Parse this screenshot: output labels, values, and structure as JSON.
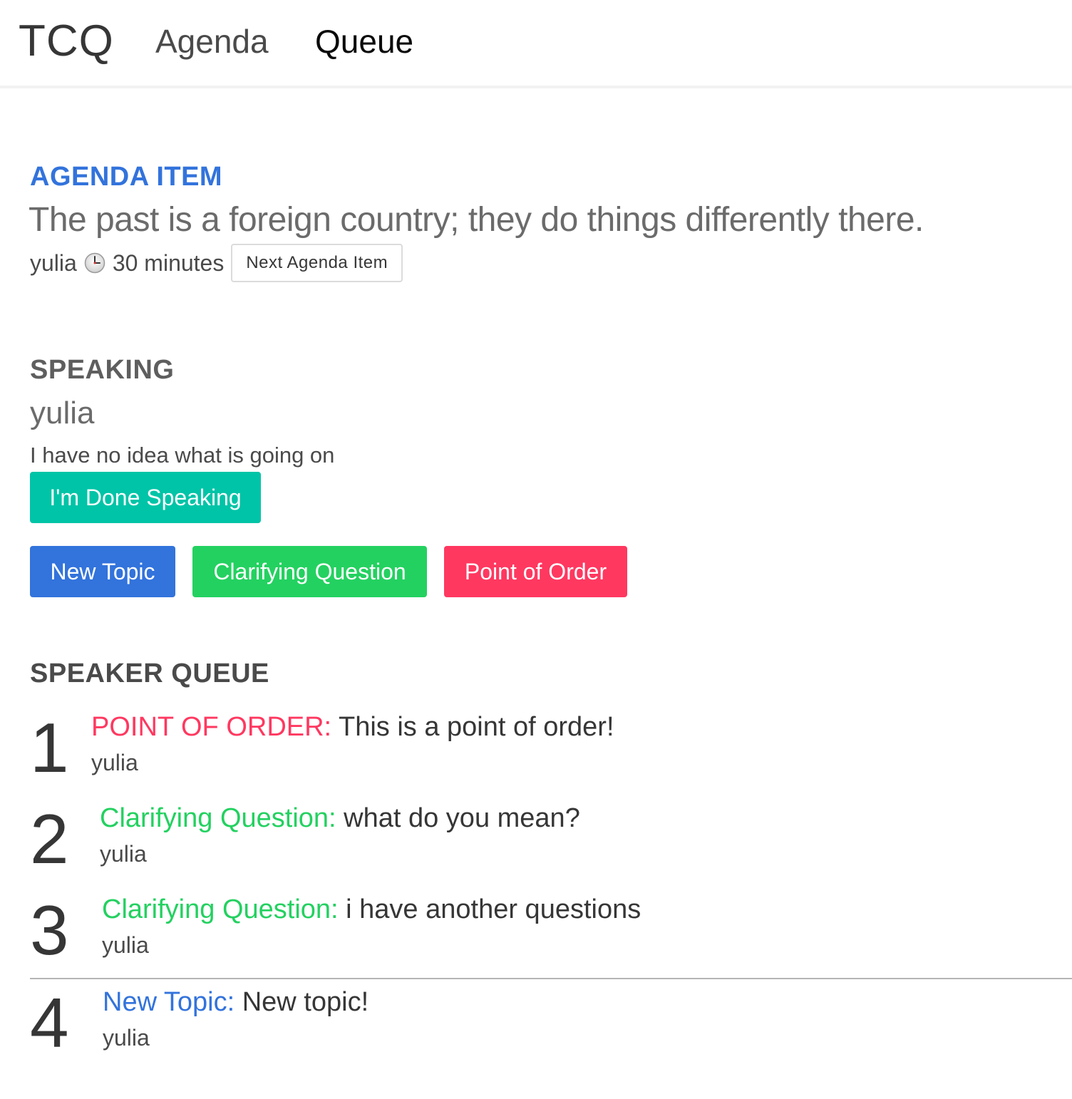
{
  "nav": {
    "brand": "TCQ",
    "links": [
      {
        "label": "Agenda",
        "active": false
      },
      {
        "label": "Queue",
        "active": true
      }
    ]
  },
  "agenda_item": {
    "heading": "AGENDA ITEM",
    "title": "The past is a foreign country; they do things differently there.",
    "owner": "yulia",
    "duration": "30 minutes",
    "clock_icon": "clock-icon",
    "next_button_label": "Next Agenda Item"
  },
  "speaking": {
    "heading": "SPEAKING",
    "speaker": "yulia",
    "topic": "I have no idea what is going on",
    "done_button_label": "I'm Done Speaking"
  },
  "actions": {
    "new_topic_label": "New Topic",
    "clarifying_question_label": "Clarifying Question",
    "point_of_order_label": "Point of Order"
  },
  "speaker_queue": {
    "heading": "SPEAKER QUEUE",
    "items": [
      {
        "number": "1",
        "type": "POINT OF ORDER:",
        "topic": "This is a point of order!",
        "speaker": "yulia"
      },
      {
        "number": "2",
        "type": "Clarifying Question:",
        "topic": "what do you mean?",
        "speaker": "yulia"
      },
      {
        "number": "3",
        "type": "Clarifying Question:",
        "topic": "i have another questions",
        "speaker": "yulia"
      },
      {
        "number": "4",
        "type": "New Topic:",
        "topic": "New topic!",
        "speaker": "yulia"
      }
    ]
  },
  "colors": {
    "primary": "#3273dc",
    "success": "#23d160",
    "danger": "#ff3860",
    "teal": "#00c4a7"
  }
}
